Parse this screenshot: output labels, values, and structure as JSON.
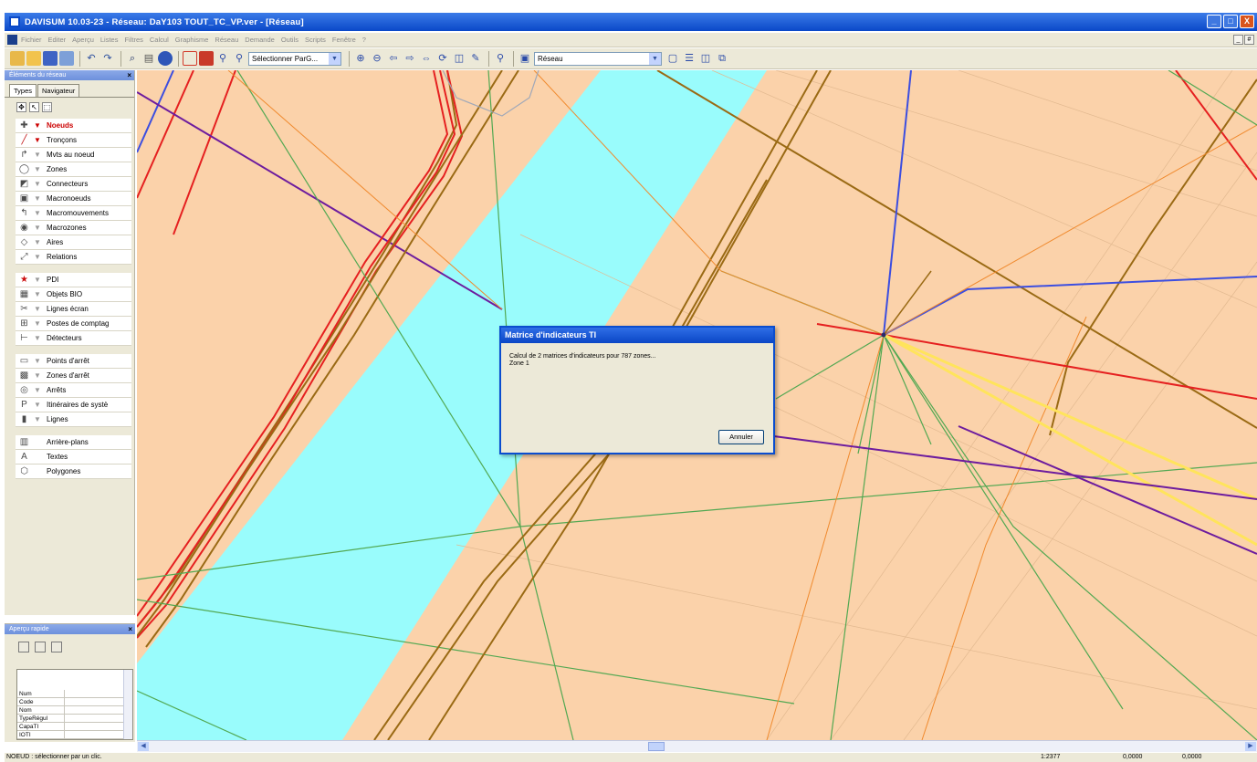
{
  "window": {
    "title": "DAVISUM 10.03-23 - Réseau: DaY103 TOUT_TC_VP.ver - [Réseau]",
    "buttons": [
      "_",
      "□",
      "X"
    ]
  },
  "menu": {
    "items": [
      "Fichier",
      "Editer",
      "Aperçu",
      "Listes",
      "Filtres",
      "Calcul",
      "Graphisme",
      "Réseau",
      "Demande",
      "Outils",
      "Scripts",
      "Fenêtre",
      "?"
    ],
    "mdi_buttons": [
      "_",
      "#"
    ]
  },
  "toolbar": {
    "selection_combo": "Sélectionner ParG...",
    "view_combo": "Réseau"
  },
  "elements_panel": {
    "title": "Éléments du réseau",
    "close": "×",
    "tabs": [
      "Types",
      "Navigateur"
    ],
    "mode_icons": [
      "move-icon",
      "pointer-icon",
      "select-box-icon"
    ],
    "groups": [
      [
        {
          "label": "Noeuds",
          "icon": "node-icon",
          "selected": true
        },
        {
          "label": "Tronçons",
          "icon": "link-icon",
          "filter_active": true
        },
        {
          "label": "Mvts au noeud",
          "icon": "turn-icon"
        },
        {
          "label": "Zones",
          "icon": "zone-icon"
        },
        {
          "label": "Connecteurs",
          "icon": "connector-icon"
        },
        {
          "label": "Macronoeuds",
          "icon": "macronode-icon"
        },
        {
          "label": "Macromouvements",
          "icon": "macroturn-icon"
        },
        {
          "label": "Macrozones",
          "icon": "macrozone-icon"
        },
        {
          "label": "Aires",
          "icon": "area-icon"
        },
        {
          "label": "Relations",
          "icon": "relation-icon"
        }
      ],
      [
        {
          "label": "PDI",
          "icon": "star-icon"
        },
        {
          "label": "Objets BIO",
          "icon": "bio-icon"
        },
        {
          "label": "Lignes écran",
          "icon": "screenline-icon"
        },
        {
          "label": "Postes de comptag",
          "icon": "count-icon"
        },
        {
          "label": "Détecteurs",
          "icon": "detector-icon"
        }
      ],
      [
        {
          "label": "Points d'arrêt",
          "icon": "stop-point-icon"
        },
        {
          "label": "Zones d'arrêt",
          "icon": "stop-area-icon"
        },
        {
          "label": "Arrêts",
          "icon": "stop-icon"
        },
        {
          "label": "Itinéraires de systè",
          "icon": "route-icon"
        },
        {
          "label": "Lignes",
          "icon": "line-icon"
        }
      ],
      [
        {
          "label": "Arrière-plans",
          "icon": "background-icon",
          "no_filter": true
        },
        {
          "label": "Textes",
          "icon": "text-icon",
          "no_filter": true
        },
        {
          "label": "Polygones",
          "icon": "polygon-icon",
          "no_filter": true
        }
      ]
    ]
  },
  "quick_panel": {
    "title": "Aperçu rapide",
    "close": "×",
    "rows": [
      "Num",
      "Code",
      "Nom",
      "TypeRégul",
      "CapaTI",
      "IOTI"
    ]
  },
  "dialog": {
    "title": "Matrice d'indicateurs TI",
    "line1": "Calcul de 2 matrices d'indicateurs pour 787 zones...",
    "line2": "Zone 1",
    "cancel": "Annuler"
  },
  "status": {
    "message": "NOEUD : sélectionner par un clic.",
    "scale": "1:2377",
    "x": "0,0000",
    "y": "0,0000"
  },
  "colors": {
    "land": "#fbd2aa",
    "water": "#99fcfc",
    "link_red": "#e52020",
    "link_brown": "#9a6a14",
    "link_green": "#52a852",
    "link_blue": "#3c4ee0",
    "link_purple": "#6d1c9e",
    "link_orange": "#f08a2e",
    "link_yellow": "#ffe45c"
  }
}
